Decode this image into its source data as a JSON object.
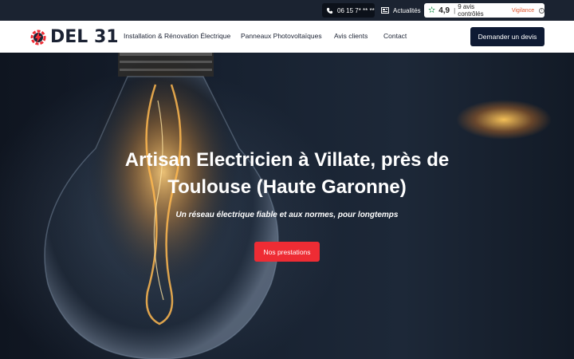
{
  "topbar": {
    "phone": "06 15 7* ** **",
    "news_label": "Actualités",
    "rating_score": "4,9",
    "rating_count": "9 avis contrôlés",
    "vigilance_label": "Vigilance",
    "phone_icon": "phone-icon",
    "news_icon": "newspaper-icon",
    "star_icon": "star-icon"
  },
  "brand": {
    "name": "DEL 31",
    "logo_icon": "lightning-gear-icon",
    "accent": "#ee2c34",
    "navy": "#0e1a33"
  },
  "nav": {
    "items": [
      "Installation & Rénovation Électrique",
      "Panneaux Photovoltaïques",
      "Avis clients",
      "Contact"
    ],
    "cta": "Demander un devis"
  },
  "hero": {
    "title_line1": "Artisan Electricien à Villate, près de",
    "title_line2": "Toulouse (Haute Garonne)",
    "subtitle": "Un réseau électrique fiable et aux normes, pour longtemps",
    "button": "Nos prestations"
  }
}
